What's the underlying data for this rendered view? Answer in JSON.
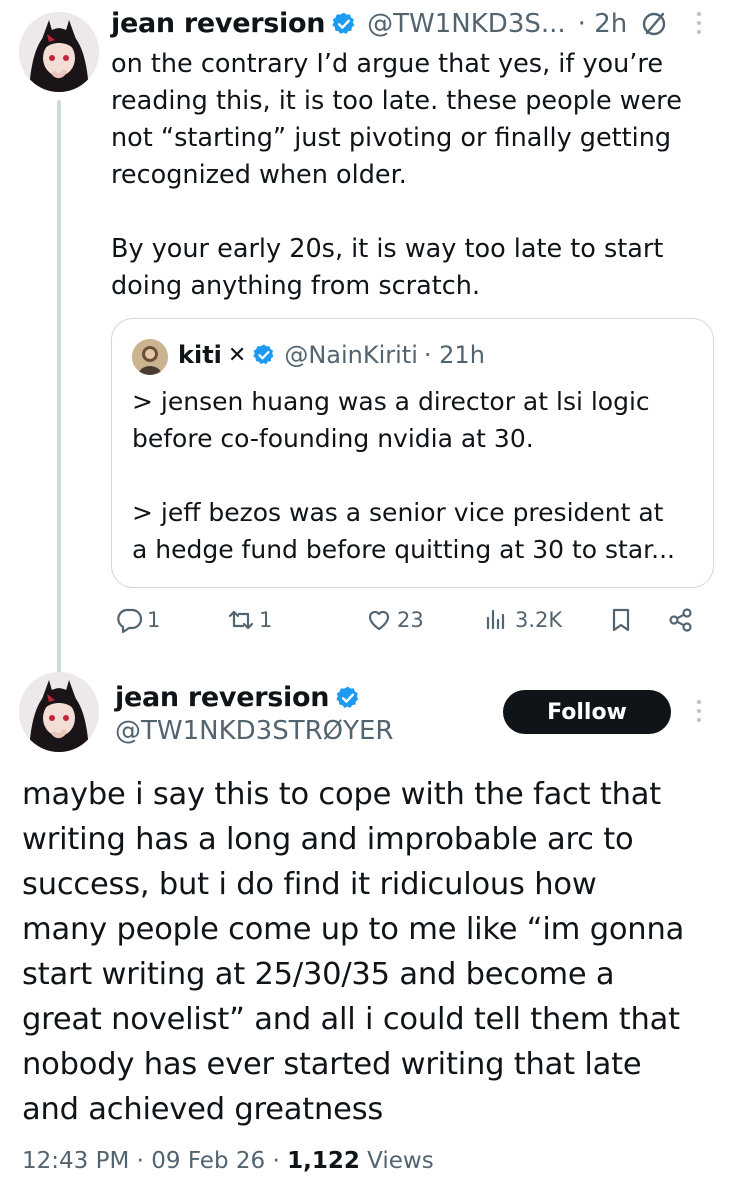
{
  "reply": {
    "display_name": "jean reversion",
    "handle": "@TW1NKD3S...",
    "time": "· 2h",
    "text": "on the contrary I’d argue that yes, if you’re\nreading this, it is too late. these people were\nnot “starting” just pivoting or finally getting\nrecognized when older.\n\nBy your early 20s, it is way too late to start\ndoing anything from scratch.",
    "quote": {
      "display_name": "kiti",
      "name_glyph": "✕",
      "handle": "@NainKiriti",
      "time": "· 21h",
      "text": "> jensen huang was a director at lsi logic\nbefore co-founding nvidia at 30.\n\n> jeff bezos was a senior vice president at\na hedge fund before quitting at 30 to star..."
    },
    "actions": {
      "replies": "1",
      "reposts": "1",
      "likes": "23",
      "views": "3.2K"
    }
  },
  "main": {
    "display_name": "jean reversion",
    "handle": "@TW1NKD3STRØYER",
    "follow_label": "Follow",
    "text": "maybe i say this to cope with the fact that\nwriting has a long and improbable arc to\nsuccess, but i do find it ridiculous how\nmany people come up to me like “im gonna\nstart writing at 25/30/35 and become a\ngreat novelist” and all i could tell them that\nnobody has ever started writing that late\nand achieved greatness",
    "meta": {
      "time": "12:43 PM",
      "sep1": " · ",
      "date": "09 Feb 26",
      "sep2": " · ",
      "views_count": "1,122",
      "views_label": " Views"
    }
  },
  "colors": {
    "verified": "#1d9bf0",
    "secondary_text": "#536471",
    "follow_bg": "#0f1419",
    "thread_line": "#cfd9de"
  },
  "icons": [
    "verified-badge-icon",
    "grok-icon",
    "more-icon",
    "reply-icon",
    "repost-icon",
    "like-icon",
    "views-icon",
    "bookmark-icon",
    "share-icon"
  ]
}
